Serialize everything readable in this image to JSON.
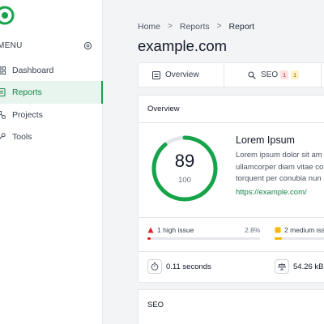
{
  "sidebar": {
    "menu_label": "MENU",
    "items": [
      {
        "label": "Dashboard",
        "icon": "grid-icon",
        "active": false
      },
      {
        "label": "Reports",
        "icon": "report-icon",
        "active": true
      },
      {
        "label": "Projects",
        "icon": "projects-icon",
        "active": false
      },
      {
        "label": "Tools",
        "icon": "tools-icon",
        "active": false
      }
    ]
  },
  "breadcrumb": [
    "Home",
    "Reports",
    "Report"
  ],
  "page_title": "example.com",
  "tabs": {
    "overview": {
      "label": "Overview",
      "icon": "list-icon"
    },
    "seo": {
      "label": "SEO",
      "icon": "search-icon",
      "badge_red": "1",
      "badge_yellow": "1"
    }
  },
  "overview": {
    "title": "Overview",
    "score": "89",
    "score_max": "100",
    "score_fraction": 0.89,
    "summary_title": "Lorem Ipsum",
    "summary_lines": [
      "Lorem ipsum dolor sit am",
      "ullamcorper diam vitae co",
      "torquent per conubia nun"
    ],
    "link": "https://example.com/",
    "issues": {
      "high": {
        "label": "1 high issue",
        "percent": "2.8%",
        "fill_fraction": 0.028
      },
      "medium": {
        "label": "2 medium issu"
      }
    },
    "stats": {
      "load_time": "0.11 seconds",
      "size": "54.26 kB"
    }
  },
  "seo_card": {
    "title": "SEO"
  },
  "colors": {
    "accent": "#16a34a",
    "accent_text": "#16834a",
    "high": "#dc2626",
    "medium": "#f5b800"
  }
}
